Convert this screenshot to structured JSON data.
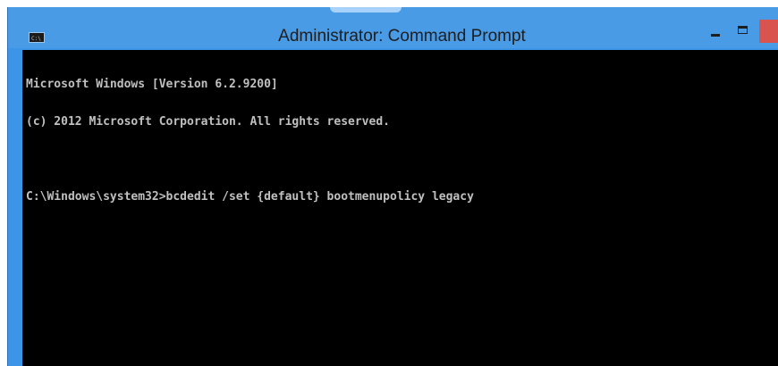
{
  "window": {
    "title": "Administrator: Command Prompt",
    "icon": "cmd-icon",
    "controls": [
      "minimize-icon",
      "maximize-icon",
      "close-icon"
    ],
    "accent_color": "#4a9be6",
    "close_color": "#d9534f"
  },
  "console": {
    "background": "#000000",
    "text_color": "#c0c0c0",
    "lines": [
      "Microsoft Windows [Version 6.2.9200]",
      "(c) 2012 Microsoft Corporation. All rights reserved.",
      "",
      "C:\\Windows\\system32>bcdedit /set {default} bootmenupolicy legacy"
    ]
  }
}
